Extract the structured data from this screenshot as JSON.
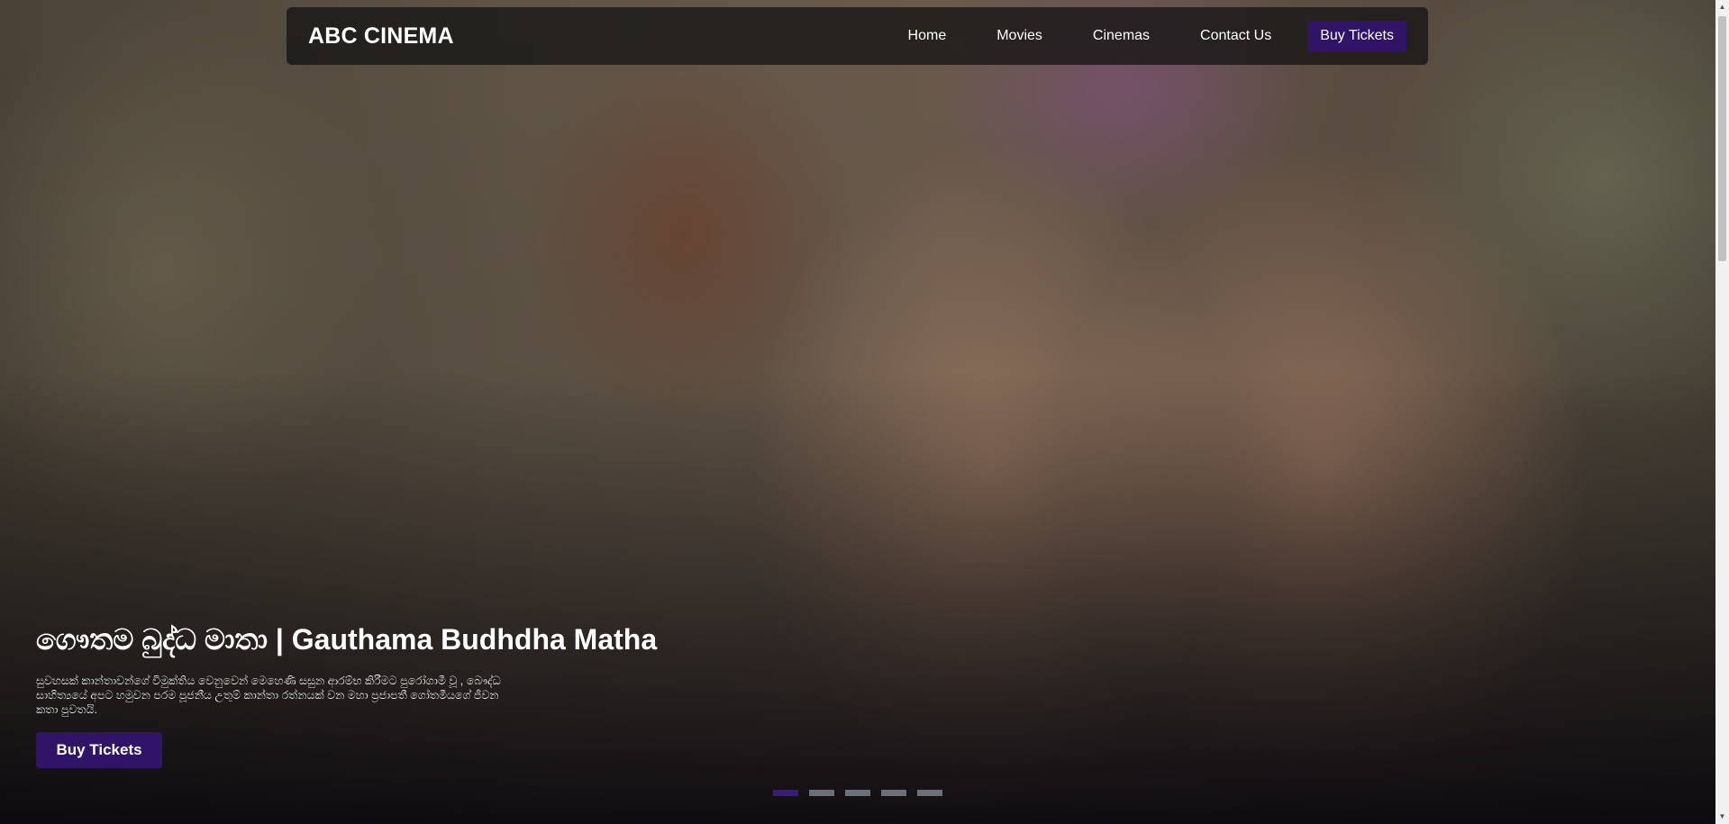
{
  "nav": {
    "brand": "ABC CINEMA",
    "links": [
      "Home",
      "Movies",
      "Cinemas",
      "Contact Us"
    ],
    "cta": "Buy Tickets"
  },
  "hero": {
    "title": "ගෞතම බුද්ධ මාතා | Gauthama Budhdha Matha",
    "description": "සුවහසක් කාන්තාවන්ගේ විමුක්තිය වෙනුවෙන් මෙහෙණි සසුන ආරම්භ කිරීමට පුරෝගාමී වූ , බෞද්ධ සාහිත්‍යයේ අපට හමුවන පරම පූජනීය උතුම් කාන්තා රත්නයක් වන මහා ප්‍රජාපතී ගෝතමීයගේ ජීවන කතා පුවතයි.",
    "button": "Buy Tickets"
  },
  "carousel": {
    "count": 5,
    "active_index": 0
  },
  "colors": {
    "accent": "#2f1468",
    "indicator_active": "#3a1a7a",
    "indicator_inactive": "#6b6f78"
  }
}
